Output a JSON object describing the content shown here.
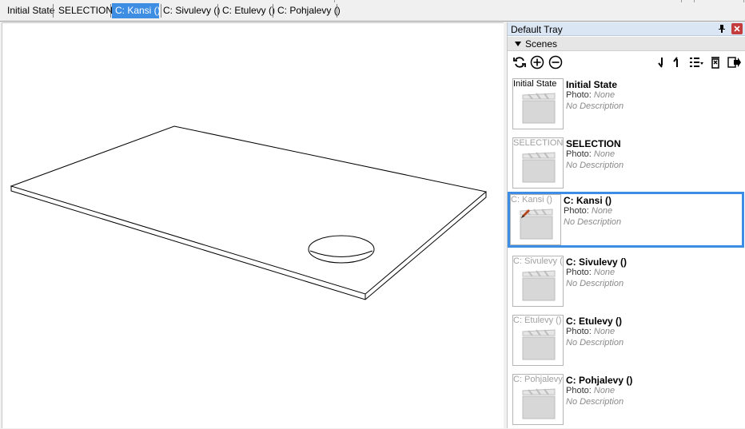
{
  "tabs": [
    {
      "label": "Initial State",
      "active": false
    },
    {
      "label": "SELECTION",
      "active": false
    },
    {
      "label": "C: Kansi ()",
      "active": true
    },
    {
      "label": "C: Sivulevy ()",
      "active": false
    },
    {
      "label": "C: Etulevy ()",
      "active": false
    },
    {
      "label": "C: Pohjalevy ()",
      "active": false
    }
  ],
  "tray": {
    "title": "Default Tray",
    "section_label": "Scenes",
    "toolbar_icons": [
      "refresh-icon",
      "add-icon",
      "remove-icon",
      "move-down-icon",
      "move-up-icon",
      "view-options-icon",
      "delete-icon",
      "export-icon"
    ]
  },
  "scenes": [
    {
      "thumb_label": "Initial State",
      "name": "Initial State",
      "photo_label": "Photo:",
      "photo_value": "None",
      "description": "No Description",
      "active": false
    },
    {
      "thumb_label": "SELECTION",
      "name": "SELECTION",
      "photo_label": "Photo:",
      "photo_value": "None",
      "description": "No Description",
      "active": false
    },
    {
      "thumb_label": "C: Kansi ()",
      "name": "C: Kansi ()",
      "photo_label": "Photo:",
      "photo_value": "None",
      "description": "No Description",
      "active": true
    },
    {
      "thumb_label": "C: Sivulevy ()",
      "name": "C: Sivulevy ()",
      "photo_label": "Photo:",
      "photo_value": "None",
      "description": "No Description",
      "active": false
    },
    {
      "thumb_label": "C: Etulevy ()",
      "name": "C: Etulevy ()",
      "photo_label": "Photo:",
      "photo_value": "None",
      "description": "No Description",
      "active": false
    },
    {
      "thumb_label": "C: Pohjalevy ()",
      "name": "C: Pohjalevy ()",
      "photo_label": "Photo:",
      "photo_value": "None",
      "description": "No Description",
      "active": false
    }
  ],
  "colors": {
    "active_tab": "#3d8de3",
    "selected_scene_border": "#3b8ee4",
    "tray_header": "#dbe6f4",
    "close_button": "#c43c3c"
  }
}
